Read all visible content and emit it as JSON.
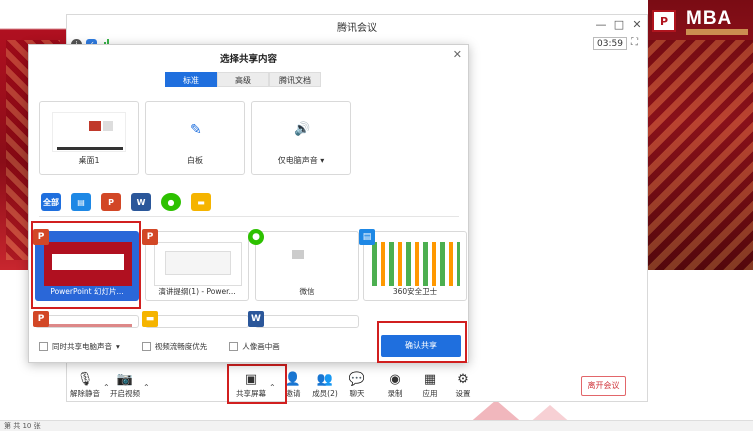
{
  "meeting": {
    "title": "腾讯会议",
    "timer": "03:59",
    "leave_label": "离开会议"
  },
  "brand": {
    "logo_text": "MBA"
  },
  "dialog": {
    "title": "选择共享内容",
    "tabs": [
      {
        "label": "标准",
        "active": true
      },
      {
        "label": "高级",
        "active": false
      },
      {
        "label": "腾讯文档",
        "active": false
      }
    ],
    "top_tiles": [
      {
        "label": "桌面1",
        "icon": "desktop-icon"
      },
      {
        "label": "白板",
        "icon": "pen-icon"
      },
      {
        "label": "仅电脑声音",
        "icon": "speaker-icon",
        "has_dropdown": true
      }
    ],
    "categories": [
      {
        "label": "全部",
        "icon": "all-icon",
        "color": "#1f6fde"
      },
      {
        "label": "",
        "icon": "screen-app-icon",
        "color": "#1e88e5"
      },
      {
        "label": "P",
        "icon": "powerpoint-icon",
        "color": "#d24726"
      },
      {
        "label": "W",
        "icon": "word-icon",
        "color": "#2b579a"
      },
      {
        "label": "",
        "icon": "wechat-icon",
        "color": "#2dc100"
      },
      {
        "label": "",
        "icon": "folder-icon",
        "color": "#f5b400"
      }
    ],
    "windows": [
      {
        "label": "PowerPoint 幻灯片...",
        "badge": "P",
        "badge_type": "ppt",
        "selected": true
      },
      {
        "label": "演讲提纲(1) - Power...",
        "badge": "P",
        "badge_type": "ppt",
        "selected": false
      },
      {
        "label": "微信",
        "badge": "",
        "badge_type": "wx",
        "selected": false
      },
      {
        "label": "360安全卫士",
        "badge": "",
        "badge_type": "blue",
        "selected": false
      },
      {
        "label": "",
        "badge": "P",
        "badge_type": "ppt",
        "selected": false
      },
      {
        "label": "",
        "badge": "",
        "badge_type": "folder",
        "selected": false
      },
      {
        "label": "",
        "badge": "W",
        "badge_type": "word",
        "selected": false
      }
    ],
    "options": [
      {
        "label": "同时共享电脑声音",
        "has_dropdown": true
      },
      {
        "label": "视频流畅度优先",
        "has_dropdown": false
      },
      {
        "label": "人像画中画",
        "has_dropdown": false
      }
    ],
    "confirm_label": "确认共享"
  },
  "toolbar": {
    "items": [
      {
        "label": "解除静音",
        "icon": "mic-muted-icon"
      },
      {
        "label": "开启视频",
        "icon": "camera-off-icon"
      },
      {
        "label": "共享屏幕",
        "icon": "share-screen-icon"
      },
      {
        "label": "邀请",
        "icon": "invite-icon"
      },
      {
        "label": "成员(2)",
        "icon": "members-icon"
      },
      {
        "label": "聊天",
        "icon": "chat-icon"
      },
      {
        "label": "录制",
        "icon": "record-icon"
      },
      {
        "label": "应用",
        "icon": "apps-icon"
      },
      {
        "label": "设置",
        "icon": "gear-icon"
      }
    ]
  },
  "statusbar": {
    "text": "第 共 10 张"
  }
}
